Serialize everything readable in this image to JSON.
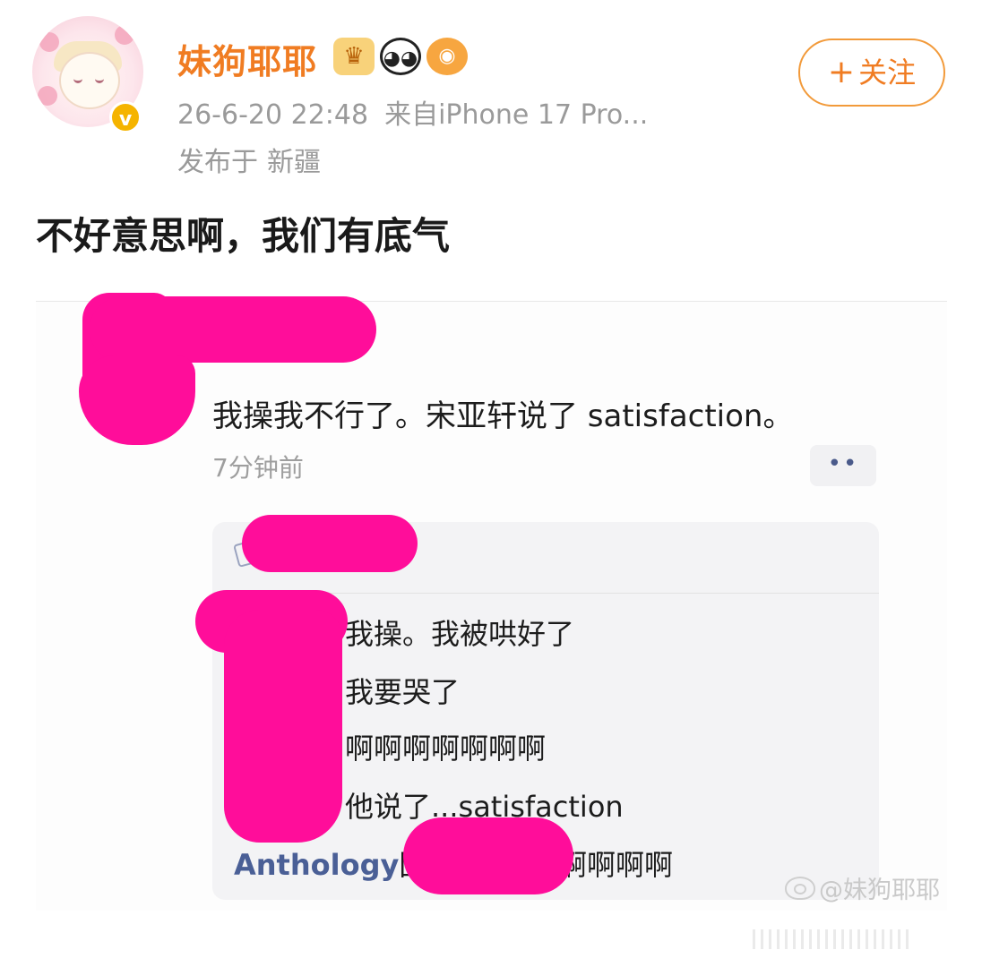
{
  "header": {
    "username": "妹狗耶耶",
    "verified_mark": "v",
    "badges": [
      {
        "icon": "crown-icon",
        "glyph": "♛"
      },
      {
        "icon": "panda-icon",
        "glyph": "◕◕"
      },
      {
        "icon": "fish-icon",
        "glyph": "◉"
      }
    ],
    "timestamp": "26-6-20 22:48",
    "source": "来自iPhone 17 Pro...",
    "location_prefix": "发布于",
    "location": "新疆",
    "follow_plus": "+",
    "follow_label": "关注"
  },
  "post": {
    "text": "不好意思啊，我们有底气"
  },
  "screenshot": {
    "comment": "我操我不行了。宋亚轩说了 satisfaction。",
    "time_ago": "7分钟前",
    "more_label": "••",
    "replies": [
      "我操。我被哄好了",
      "我要哭了",
      "啊啊啊啊啊啊啊",
      "他说了...satisfaction"
    ],
    "footer_name": "Anthology",
    "footer_reply_word": "回",
    "footer_tail": "啊啊啊啊"
  },
  "watermark": {
    "text": "@妹狗耶耶"
  },
  "colors": {
    "username": "#f07c22",
    "follow_border": "#f29a3a",
    "censor": "#ff0d9a",
    "link_blue": "#4a5f96",
    "meta_gray": "#9a9a9a"
  }
}
